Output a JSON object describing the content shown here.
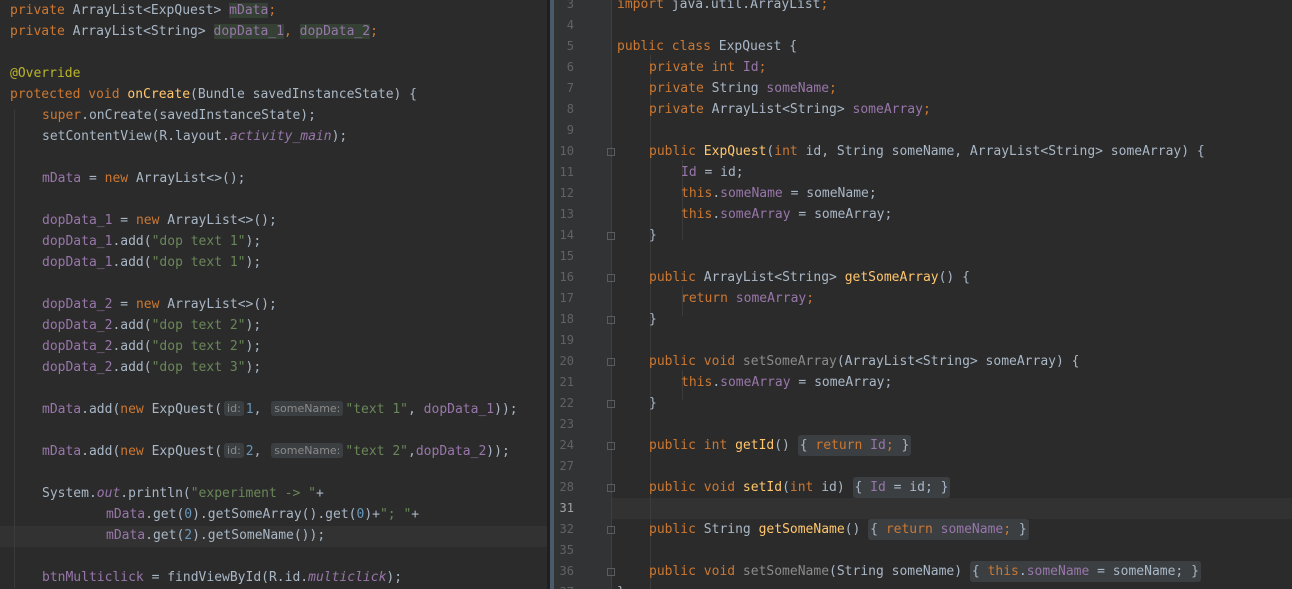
{
  "left_editor": {
    "lines": [
      [
        "private ",
        "ArrayList<ExpQuest> ",
        "mData",
        ";"
      ],
      [
        "private ",
        "ArrayList<String> ",
        "dopData_1",
        ", ",
        "dopData_2",
        ";"
      ],
      [],
      [
        "@Override"
      ],
      [
        "protected void ",
        "onCreate",
        "(Bundle savedInstanceState) {"
      ],
      [
        "super",
        ".onCreate(savedInstanceState);"
      ],
      [
        "setContentView(R.layout.",
        "activity_main",
        ");"
      ],
      [],
      [
        "mData",
        " = ",
        "new ",
        "ArrayList<>();"
      ],
      [],
      [
        "dopData_1",
        " = ",
        "new ",
        "ArrayList<>();"
      ],
      [
        "dopData_1",
        ".add(",
        "\"dop text 1\"",
        ");"
      ],
      [
        "dopData_1",
        ".add(",
        "\"dop text 1\"",
        ");"
      ],
      [],
      [
        "dopData_2",
        " = ",
        "new ",
        "ArrayList<>();"
      ],
      [
        "dopData_2",
        ".add(",
        "\"dop text 2\"",
        ");"
      ],
      [
        "dopData_2",
        ".add(",
        "\"dop text 2\"",
        ");"
      ],
      [
        "dopData_2",
        ".add(",
        "\"dop text 3\"",
        ");"
      ],
      [],
      [
        "mData",
        ".add(",
        "new ",
        "ExpQuest(",
        "id:",
        "1",
        ", ",
        "someName:",
        "\"text 1\"",
        ", ",
        "dopData_1",
        "));"
      ],
      [],
      [
        "mData",
        ".add(",
        "new ",
        "ExpQuest(",
        "id:",
        "2",
        ", ",
        "someName:",
        "\"text 2\"",
        ",",
        "dopData_2",
        "));"
      ],
      [],
      [
        "System.",
        "out",
        ".println(",
        "\"experiment -> \"",
        "+"
      ],
      [
        "mData",
        ".get(",
        "0",
        ").getSomeArray().get(",
        "0",
        ")+",
        "\"; \"",
        "+"
      ],
      [
        "mData",
        ".get(",
        "2",
        ").getSomeName());"
      ],
      [],
      [
        "btnMulticlick",
        " = findViewById(R.id.",
        "multiclick",
        ");"
      ]
    ]
  },
  "right_editor": {
    "line_numbers": [
      "3",
      "4",
      "5",
      "6",
      "7",
      "8",
      "9",
      "10",
      "11",
      "12",
      "13",
      "14",
      "15",
      "16",
      "17",
      "18",
      "19",
      "20",
      "21",
      "22",
      "23",
      "24",
      "27",
      "28",
      "31",
      "32",
      "35",
      "36",
      "37"
    ],
    "current_line": "31",
    "lines": [
      [
        "import ",
        "java.util.ArrayList",
        ";"
      ],
      [],
      [
        "public class ",
        "ExpQuest {"
      ],
      [
        "private int ",
        "Id",
        ";"
      ],
      [
        "private ",
        "String ",
        "someName",
        ";"
      ],
      [
        "private ",
        "ArrayList<String> ",
        "someArray",
        ";"
      ],
      [],
      [
        "public ",
        "ExpQuest",
        "(",
        "int ",
        "id, String someName, ArrayList<String> someArray) {"
      ],
      [
        "Id",
        " = id;"
      ],
      [
        "this",
        ".",
        "someName",
        " = someName;"
      ],
      [
        "this",
        ".",
        "someArray",
        " = someArray;"
      ],
      [
        "}"
      ],
      [],
      [
        "public ",
        "ArrayList<String> ",
        "getSomeArray",
        "() {"
      ],
      [
        "return ",
        "someArray",
        ";"
      ],
      [
        "}"
      ],
      [],
      [
        "public void ",
        "setSomeArray",
        "(ArrayList<String> someArray) {"
      ],
      [
        "this",
        ".",
        "someArray",
        " = someArray;"
      ],
      [
        "}"
      ],
      [],
      [
        "public int ",
        "getId",
        "() ",
        "{ ",
        "return ",
        "Id",
        "; ",
        "}"
      ],
      [],
      [
        "public void ",
        "setId",
        "(",
        "int ",
        "id) ",
        "{ ",
        "Id",
        " = id; ",
        "}"
      ],
      [],
      [
        "public ",
        "String ",
        "getSomeName",
        "() ",
        "{ ",
        "return ",
        "someName",
        "; ",
        "}"
      ],
      [],
      [
        "public void ",
        "setSomeName",
        "(String someName) ",
        "{ ",
        "this",
        ".",
        "someName",
        " = someName; ",
        "}"
      ],
      [
        "}"
      ]
    ]
  },
  "colors": {
    "background": "#2b2b2b",
    "gutter": "#313335",
    "keyword": "#cc7832",
    "field": "#9876aa",
    "string": "#6a8759",
    "number": "#6897bb",
    "method": "#ffc66d",
    "annotation": "#bbb529",
    "text": "#a9b7c6"
  }
}
